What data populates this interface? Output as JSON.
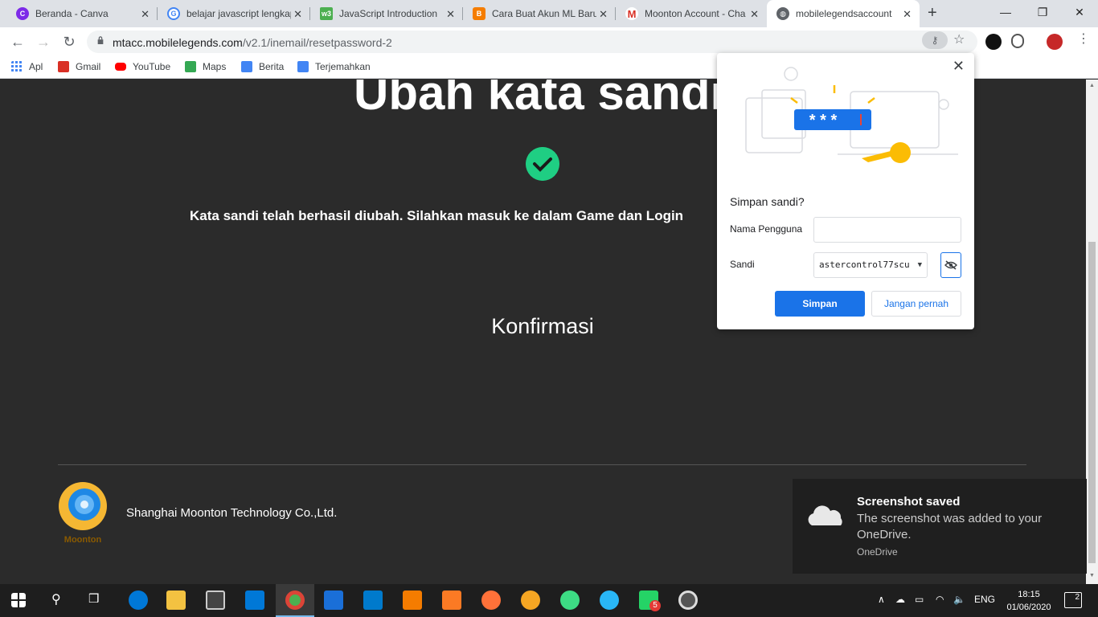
{
  "tabs": [
    {
      "title": "Beranda - Canva",
      "icon": "canva-icon",
      "color": "#7d2ae8"
    },
    {
      "title": "belajar javascript lengkap",
      "icon": "google-icon",
      "color": "#4285f4"
    },
    {
      "title": "JavaScript Introduction",
      "icon": "w3schools-icon",
      "color": "#4caf50"
    },
    {
      "title": "Cara Buat Akun ML Baru",
      "icon": "blogger-icon",
      "color": "#f57d00"
    },
    {
      "title": "Moonton Account - Cha",
      "icon": "gmail-icon",
      "color": "#d93025"
    },
    {
      "title": "mobilelegendsaccount",
      "icon": "globe-icon",
      "color": "#5f6368"
    }
  ],
  "toolbar": {
    "url_host": "mtacc.mobilelegends.com",
    "url_path": "/v2.1/inemail/resetpassword-2"
  },
  "bookmarks": [
    {
      "label": "Apl",
      "icon": "apps-grid-icon",
      "color": "#4285f4"
    },
    {
      "label": "Gmail",
      "icon": "gmail-icon",
      "color": "#d93025"
    },
    {
      "label": "YouTube",
      "icon": "youtube-icon",
      "color": "#ff0000"
    },
    {
      "label": "Maps",
      "icon": "maps-icon",
      "color": "#34a853"
    },
    {
      "label": "Berita",
      "icon": "news-icon",
      "color": "#4285f4"
    },
    {
      "label": "Terjemahkan",
      "icon": "translate-icon",
      "color": "#4285f4"
    }
  ],
  "page": {
    "heading": "Ubah kata sandi",
    "message": "Kata sandi telah berhasil diubah. Silahkan masuk ke dalam Game dan Login",
    "confirm": "Konfirmasi",
    "company": "Shanghai Moonton Technology Co.,Ltd.",
    "logo_text": "Moonton",
    "check_color": "#1fce83"
  },
  "popup": {
    "title": "Simpan sandi?",
    "username_label": "Nama Pengguna",
    "username_value": "",
    "password_label": "Sandi",
    "password_value": "astercontrol77scu",
    "save": "Simpan",
    "never": "Jangan pernah",
    "masked": "* * *",
    "accent": "#1a73e8"
  },
  "toast": {
    "title": "Screenshot saved",
    "body": "The screenshot was added to your OneDrive.",
    "source": "OneDrive"
  },
  "taskbar": {
    "language": "ENG",
    "time": "18:15",
    "date": "01/06/2020",
    "notification_count": "2",
    "whatsapp_badge": "5"
  }
}
